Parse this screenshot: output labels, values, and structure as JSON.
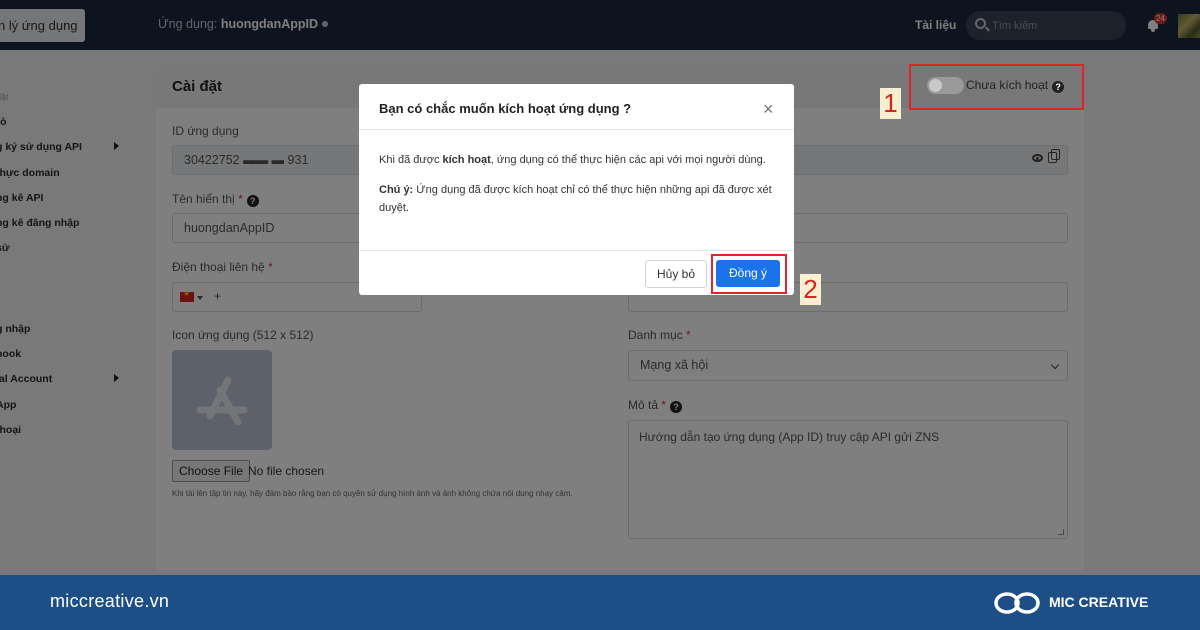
{
  "topbar": {
    "manage_label": "n lý ứng dụng",
    "app_label": "Ứng dụng:",
    "app_name": "huongdanAppID",
    "docs_label": "Tài liệu",
    "search_placeholder": "Tìm kiếm",
    "notification_count": "24"
  },
  "sidebar": {
    "items": [
      {
        "label": "đặt",
        "muted": true
      },
      {
        "label": "rò"
      },
      {
        "label": "g ký sử dụng API",
        "has_arrow": true
      },
      {
        "label": "thực domain"
      },
      {
        "label": "ng kê API"
      },
      {
        "label": "ng kê đăng nhập"
      },
      {
        "label": "sử"
      },
      {
        "label": "g nhập"
      },
      {
        "label": "hook"
      },
      {
        "label": "ial Account",
        "has_arrow": true
      },
      {
        "label": "App"
      },
      {
        "label": "thoại"
      }
    ]
  },
  "settings": {
    "title": "Cài đặt",
    "toggle_label": "Chưa kích hoạt",
    "app_id_label": "ID ứng dụng",
    "app_id_value": "30422752  ▬▬ ▬ 931",
    "display_name_label": "Tên hiển thị",
    "display_name_value": "huongdanAppID",
    "phone_label": "Điện thoại liên hệ",
    "phone_prefix": "+",
    "icon_label": "Icon ứng dụng (512 x 512)",
    "choose_file_label": "Choose File",
    "no_file_label": "No file chosen",
    "upload_hint": "Khi tải lên tập tin này, hãy đảm bảo rằng bạn có quyền sử dụng hình ảnh và ảnh không chứa nội dung nhạy cảm.",
    "category_label": "Danh mục",
    "category_value": "Mạng xã hội",
    "description_label": "Mô tả",
    "description_value": "Hướng dẫn tạo ứng dụng (App ID) truy cập API gửi ZNS",
    "required_mark": "*"
  },
  "modal": {
    "title": "Bạn có chắc muốn kích hoạt ứng dụng ?",
    "close_glyph": "×",
    "line1_prefix": "Khi đã được ",
    "line1_bold": "kích hoạt",
    "line1_suffix": ", ứng dụng có thể thực hiện các api với mọi người dùng.",
    "note_bold": "Chú ý:",
    "note_text": " Ứng dụng đã được kích hoạt chỉ có thể thực hiện những api đã được xét duyệt.",
    "cancel_label": "Hủy bỏ",
    "confirm_label": "Đồng ý"
  },
  "annotations": {
    "step1": "1",
    "step2": "2",
    "highlight_color": "#e0242b"
  },
  "footer": {
    "site": "miccreative.vn",
    "brand": "MIC CREATIVE"
  },
  "colors": {
    "topbar_bg": "#1d2640",
    "footer_bg": "#1d4f86",
    "primary_button": "#1a73e8"
  }
}
